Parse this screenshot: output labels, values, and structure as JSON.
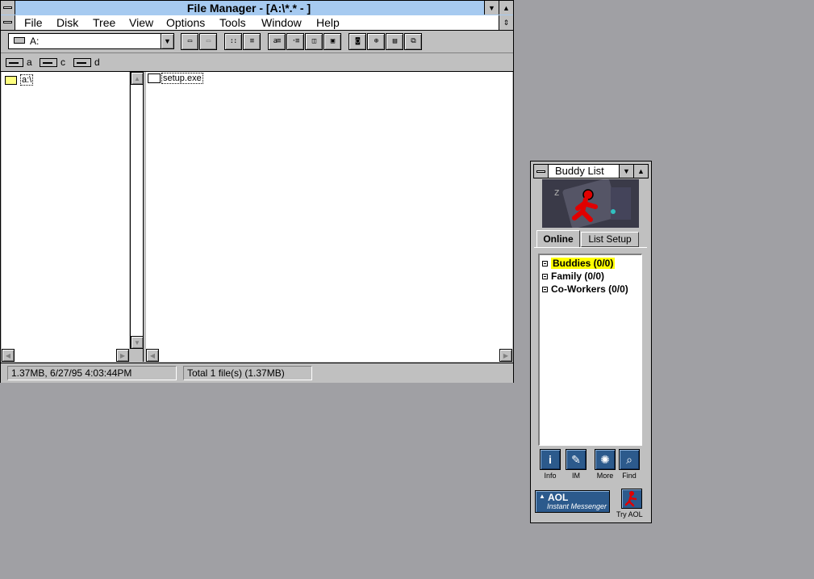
{
  "file_manager": {
    "title": "File Manager - [A:\\*.* - ]",
    "menu": [
      "File",
      "Disk",
      "Tree",
      "View",
      "Options",
      "Tools",
      "Window",
      "Help"
    ],
    "drive_combo_value": "A:",
    "drives": [
      "a",
      "c",
      "d"
    ],
    "tree_items": [
      "a:\\"
    ],
    "files": [
      "setup.exe"
    ],
    "status_left": "1.37MB, 6/27/95 4:03:44PM",
    "status_right": "Total 1 file(s) (1.37MB)"
  },
  "buddy_list": {
    "title": "Buddy List",
    "tabs": [
      "Online",
      "List Setup"
    ],
    "groups": [
      "Buddies (0/0)",
      "Family (0/0)",
      "Co-Workers (0/0)"
    ],
    "tools": [
      {
        "label": "Info",
        "icon": "info-icon"
      },
      {
        "label": "IM",
        "icon": "im-icon"
      },
      {
        "label": "More",
        "icon": "more-icon"
      },
      {
        "label": "Find",
        "icon": "find-icon"
      }
    ],
    "logo_text": "AOL",
    "logo_sub": "Instant Messenger",
    "try_aol_label": "Try AOL",
    "highlight_color": "#ffff00",
    "tool_color": "#2c5a8c"
  }
}
